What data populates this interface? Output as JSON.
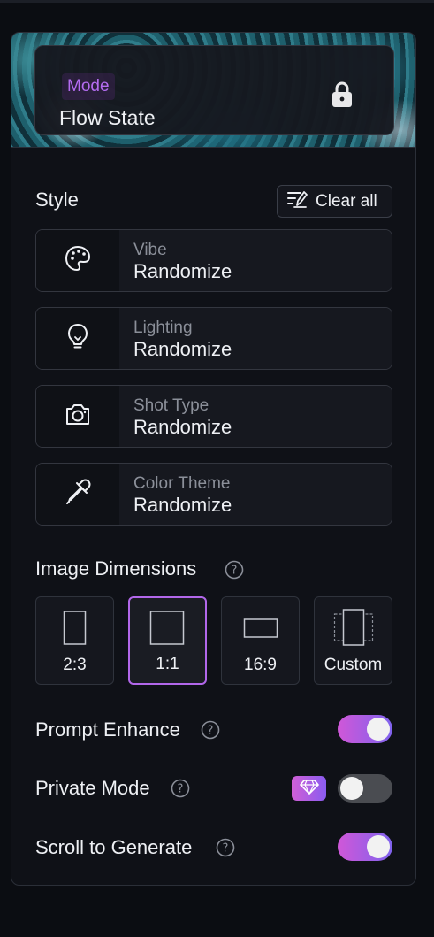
{
  "mode": {
    "label": "Mode",
    "value": "Flow State"
  },
  "style": {
    "title": "Style",
    "clear_all_label": "Clear all",
    "options": [
      {
        "label": "Vibe",
        "value": "Randomize",
        "icon": "palette-icon"
      },
      {
        "label": "Lighting",
        "value": "Randomize",
        "icon": "lightbulb-icon"
      },
      {
        "label": "Shot Type",
        "value": "Randomize",
        "icon": "camera-icon"
      },
      {
        "label": "Color Theme",
        "value": "Randomize",
        "icon": "eyedropper-icon"
      }
    ]
  },
  "dimensions": {
    "title": "Image Dimensions",
    "options": [
      "2:3",
      "1:1",
      "16:9",
      "Custom"
    ],
    "selected": "1:1"
  },
  "toggles": {
    "prompt_enhance": {
      "label": "Prompt Enhance",
      "on": true
    },
    "private_mode": {
      "label": "Private Mode",
      "on": false,
      "badge_icon": "diamond-icon"
    },
    "scroll_to_generate": {
      "label": "Scroll to Generate",
      "on": true
    }
  },
  "colors": {
    "accent": "#b267ea",
    "mode_tag": "#b46cf0",
    "toggle_gradient_start": "#d057d8",
    "toggle_gradient_end": "#7f63ee",
    "toggle_off": "#4a4c51"
  }
}
